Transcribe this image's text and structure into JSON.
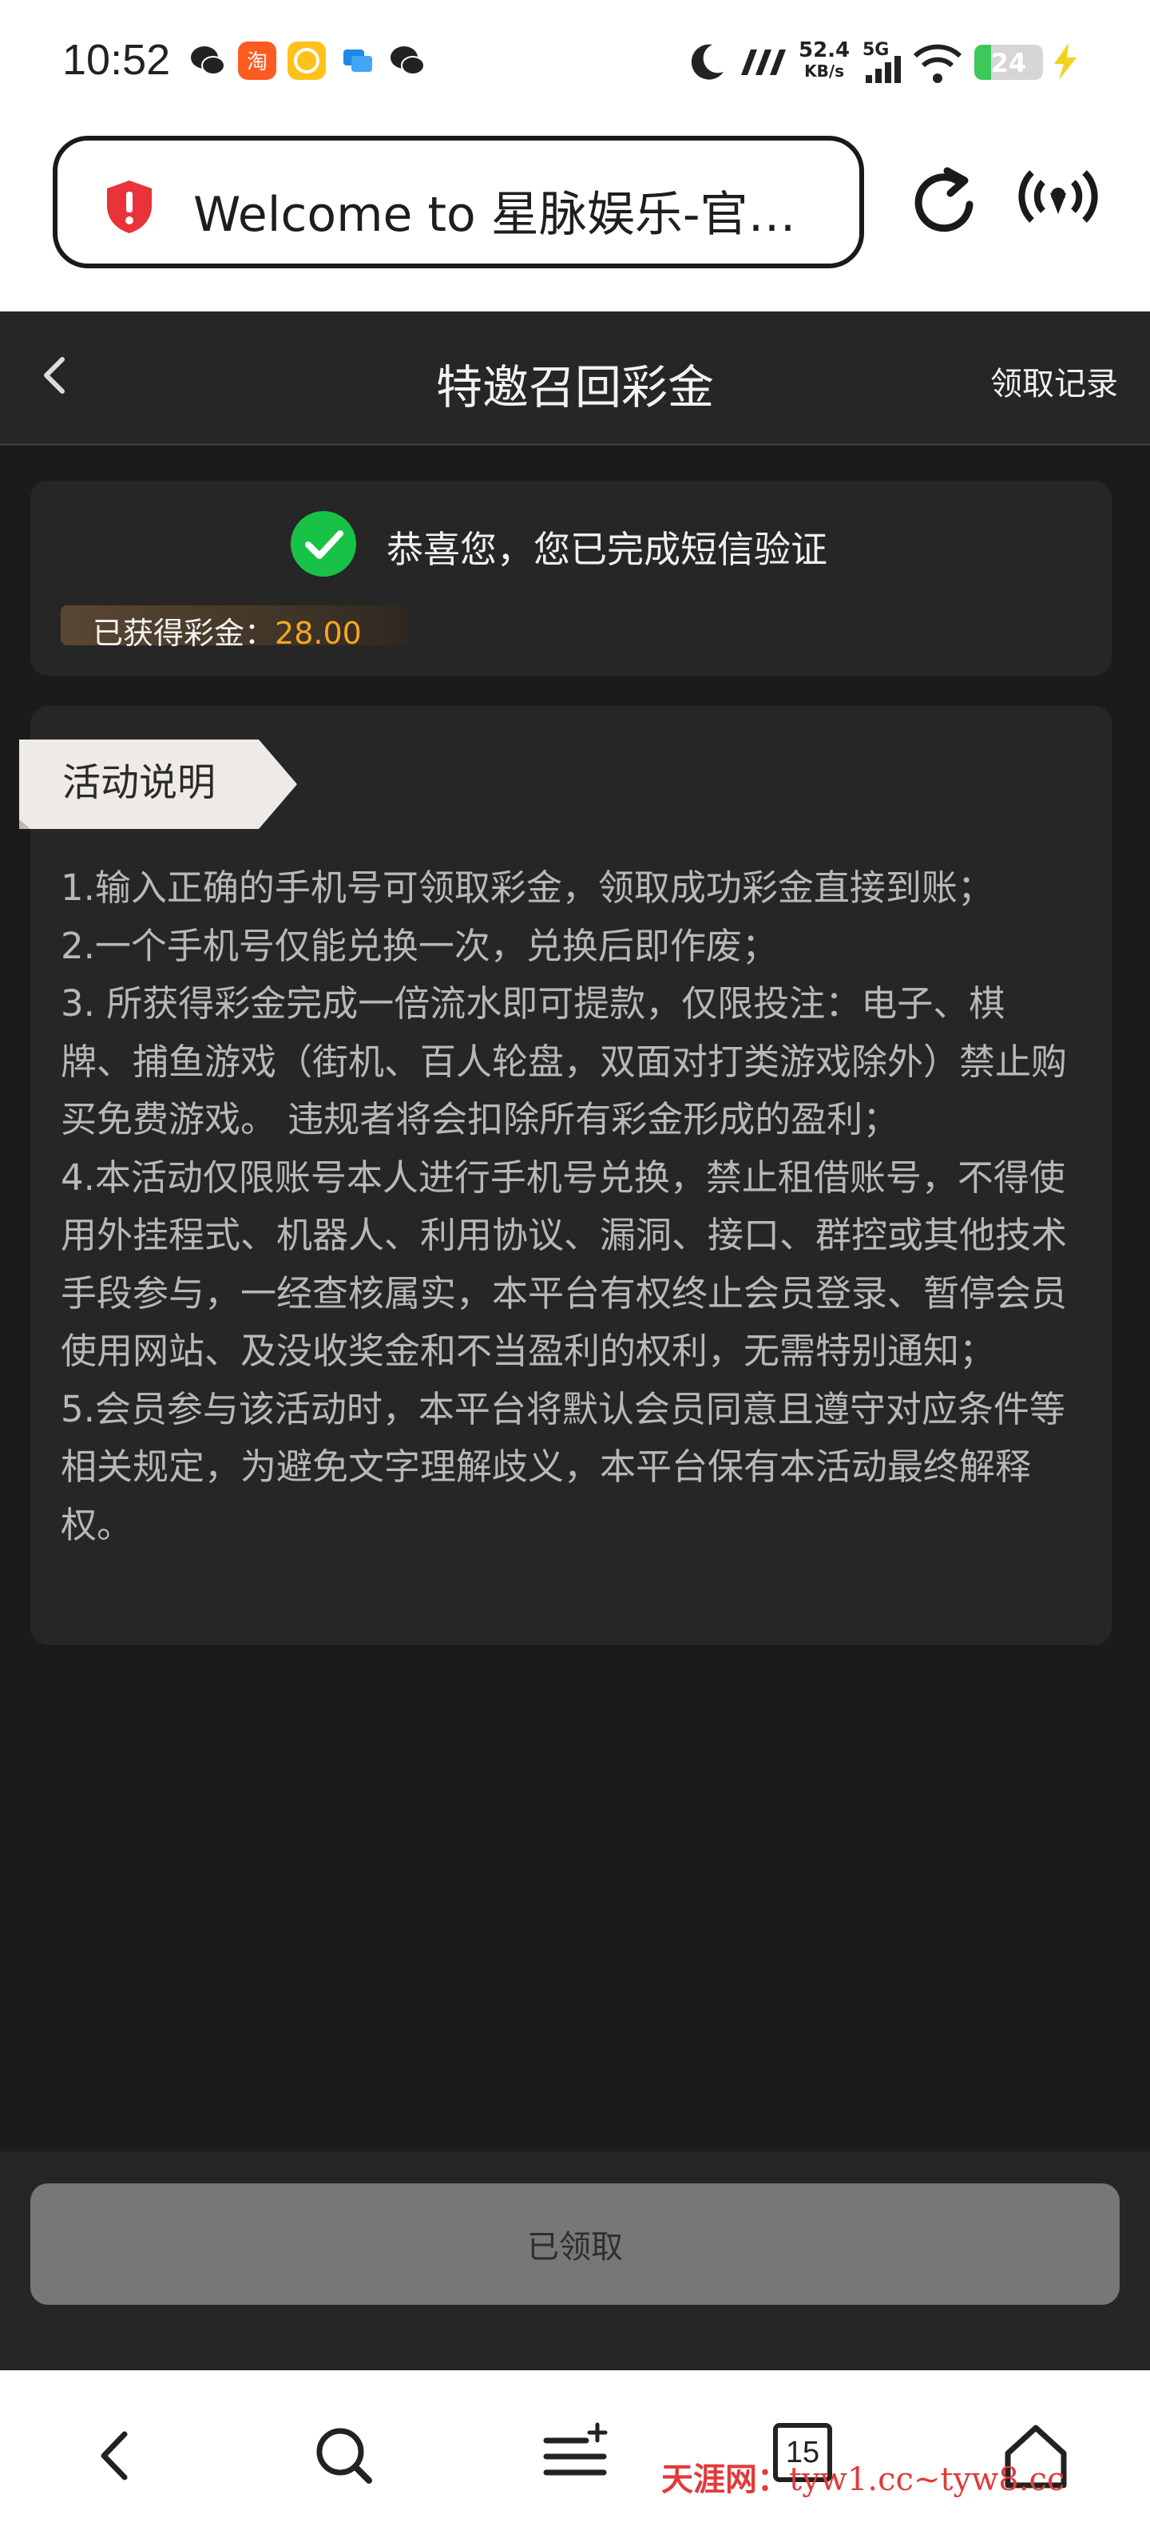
{
  "status_bar": {
    "time": "10:52",
    "net_speed_value": "52.4",
    "net_speed_unit": "KB/s",
    "network": "5G",
    "battery": "24"
  },
  "browser": {
    "url_text": "Welcome to 星脉娱乐-官…"
  },
  "header": {
    "title": "特邀召回彩金",
    "records_label": "领取记录"
  },
  "verify_card": {
    "message": "恭喜您，您已完成短信验证",
    "bonus_label": "已获得彩金：",
    "bonus_value": "28.00"
  },
  "activity": {
    "tag_label": "活动说明",
    "rules": [
      "1.输入正确的手机号可领取彩金，领取成功彩金直接到账；",
      "2.一个手机号仅能兑换一次，兑换后即作废；",
      "3. 所获得彩金完成一倍流水即可提款，仅限投注：电子、棋牌、捕鱼游戏（街机、百人轮盘，双面对打类游戏除外）禁止购买免费游戏。 违规者将会扣除所有彩金形成的盈利；",
      "4.本活动仅限账号本人进行手机号兑换，禁止租借账号，不得使用外挂程式、机器人、利用协议、漏洞、接口、群控或其他技术手段参与，一经查核属实，本平台有权终止会员登录、暂停会员使用网站、及没收奖金和不当盈利的权利，无需特别通知；",
      "5.会员参与该活动时，本平台将默认会员同意且遵守对应条件等相关规定，为避免文字理解歧义，本平台保有本活动最终解释权。"
    ]
  },
  "claim_button": {
    "label": "已领取"
  },
  "nav": {
    "tabs_count": "15"
  },
  "watermark": {
    "cn": "天涯网：",
    "url": "tyw1.cc~tyw8.cc"
  },
  "colors": {
    "accent_gold": "#f5a623",
    "check_green": "#18c247",
    "shield_red": "#e8333b"
  },
  "icons": [
    "wechat-icon",
    "taobao-icon",
    "hand-app-icon",
    "message-app-icon",
    "moon-icon",
    "shield-icon",
    "refresh-icon",
    "broadcast-icon",
    "back-icon",
    "check-icon",
    "nav-back-icon",
    "nav-search-icon",
    "nav-menu-icon",
    "nav-tabs-icon",
    "nav-home-icon"
  ]
}
